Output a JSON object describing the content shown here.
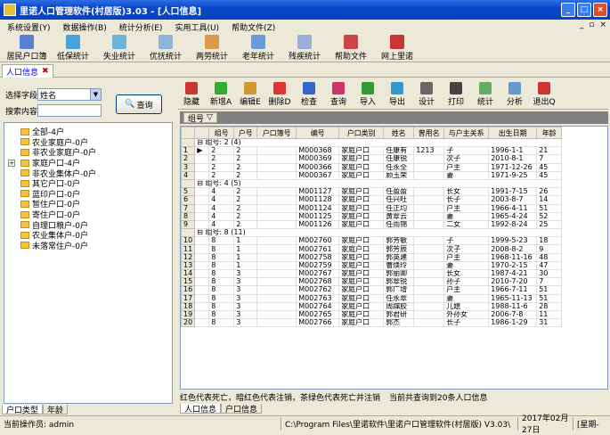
{
  "window": {
    "title": "里诺人口管理软件(村居版)3.03 - [人口信息]",
    "min": "_",
    "max": "□",
    "close": "×"
  },
  "menu": [
    "系统设置(Y)",
    "数据操作(B)",
    "统计分析(E)",
    "实用工具(U)",
    "帮助文件(Z)"
  ],
  "mdi_controls": [
    "_",
    "▫",
    "×"
  ],
  "toolbar": [
    {
      "label": "居民户口簿",
      "icon": "book-icon",
      "color": "#5a7fd6"
    },
    {
      "label": "低保统计",
      "icon": "chart-icon",
      "color": "#4aa2d6"
    },
    {
      "label": "失业统计",
      "icon": "chart-icon",
      "color": "#6cb3d9"
    },
    {
      "label": "优抚统计",
      "icon": "document-icon",
      "color": "#8fb3d9"
    },
    {
      "label": "两劳统计",
      "icon": "chart-icon",
      "color": "#d99a4a"
    },
    {
      "label": "老年统计",
      "icon": "chart-icon",
      "color": "#6c9ad9"
    },
    {
      "label": "残疾统计",
      "icon": "chart-icon",
      "color": "#9ab0d9"
    },
    {
      "label": "帮助文件",
      "icon": "help-icon",
      "color": "#c44"
    },
    {
      "label": "网上里诺",
      "icon": "house-icon",
      "color": "#c33"
    }
  ],
  "doc_tab": "人口信息",
  "search": {
    "field_label": "选择字段",
    "field_value": "姓名",
    "content_label": "搜索内容",
    "content_value": "",
    "button": "查询"
  },
  "tree": [
    {
      "label": "全部-4户",
      "expand": ""
    },
    {
      "label": "农业家庭户-0户",
      "expand": ""
    },
    {
      "label": "非农业家庭户-0户",
      "expand": ""
    },
    {
      "label": "家庭户口-4户",
      "expand": "+"
    },
    {
      "label": "非农业集体户-0户",
      "expand": ""
    },
    {
      "label": "其它户口-0户",
      "expand": ""
    },
    {
      "label": "蓝印户口-0户",
      "expand": ""
    },
    {
      "label": "暂住户口-0户",
      "expand": ""
    },
    {
      "label": "寄住户口-0户",
      "expand": ""
    },
    {
      "label": "自理口粮户-0户",
      "expand": ""
    },
    {
      "label": "农业集体户-0户",
      "expand": ""
    },
    {
      "label": "未落常住户-0户",
      "expand": ""
    }
  ],
  "left_tabs": [
    "户口类型",
    "年龄"
  ],
  "right_toolbar": [
    {
      "label": "隐藏",
      "color": "#c33"
    },
    {
      "label": "新增A",
      "color": "#3a3"
    },
    {
      "label": "编辑E",
      "color": "#c93"
    },
    {
      "label": "删除D",
      "color": "#d33"
    },
    {
      "label": "检查",
      "color": "#36c"
    },
    {
      "label": "查询",
      "color": "#c36"
    },
    {
      "label": "导入",
      "color": "#393"
    },
    {
      "label": "导出",
      "color": "#39c"
    },
    {
      "label": "设计",
      "color": "#666"
    },
    {
      "label": "打印",
      "color": "#444"
    },
    {
      "label": "统计",
      "color": "#6a6"
    },
    {
      "label": "分析",
      "color": "#69c"
    },
    {
      "label": "退出Q",
      "color": "#c33"
    }
  ],
  "group_chip": "组号",
  "columns": [
    "组号",
    "户号",
    "户口簿号",
    "编号",
    "户口类别",
    "姓名",
    "曾用名",
    "与户主关系",
    "出生日期",
    "年龄"
  ],
  "groups": [
    {
      "header": "组号: 2 (4)",
      "rows": [
        [
          "1",
          "2",
          "2",
          "",
          "M000368",
          "家庭户口",
          "任康有",
          "1213",
          "子",
          "1996-1-1",
          "21"
        ],
        [
          "2",
          "2",
          "2",
          "",
          "M000369",
          "家庭户口",
          "任康锐",
          "",
          "次子",
          "2010-8-1",
          "7"
        ],
        [
          "3",
          "2",
          "2",
          "",
          "M000366",
          "家庭户口",
          "任永全",
          "",
          "户主",
          "1971-12-26",
          "45"
        ],
        [
          "4",
          "2",
          "2",
          "",
          "M000367",
          "家庭户口",
          "顾玉荣",
          "",
          "妻",
          "1971-9-25",
          "45"
        ]
      ]
    },
    {
      "header": "组号: 4 (5)",
      "rows": [
        [
          "5",
          "4",
          "2",
          "",
          "M001127",
          "家庭户口",
          "任盈盈",
          "",
          "长女",
          "1991-7-15",
          "26"
        ],
        [
          "6",
          "4",
          "2",
          "",
          "M001128",
          "家庭户口",
          "任兴旺",
          "",
          "长子",
          "2003-8-7",
          "14"
        ],
        [
          "7",
          "4",
          "2",
          "",
          "M001124",
          "家庭户口",
          "任正均",
          "",
          "户主",
          "1966-4-11",
          "51"
        ],
        [
          "8",
          "4",
          "2",
          "",
          "M001125",
          "家庭户口",
          "黄翠云",
          "",
          "妻",
          "1965-4-24",
          "52"
        ],
        [
          "9",
          "4",
          "2",
          "",
          "M001126",
          "家庭户口",
          "任雨锦",
          "",
          "二女",
          "1992-8-24",
          "25"
        ]
      ]
    },
    {
      "header": "组号: 8 (11)",
      "rows": [
        [
          "10",
          "8",
          "1",
          "",
          "M002760",
          "家庭户口",
          "郭芳敏",
          "",
          "子",
          "1999-5-23",
          "18"
        ],
        [
          "11",
          "8",
          "1",
          "",
          "M002761",
          "家庭户口",
          "郭芳辰",
          "",
          "次子",
          "2008-8-2",
          "9"
        ],
        [
          "12",
          "8",
          "1",
          "",
          "M002758",
          "家庭户口",
          "郭英建",
          "",
          "户主",
          "1968-11-16",
          "48"
        ],
        [
          "13",
          "8",
          "1",
          "",
          "M002759",
          "家庭户口",
          "曹焕玲",
          "",
          "妻",
          "1970-2-15",
          "47"
        ],
        [
          "14",
          "8",
          "3",
          "",
          "M002767",
          "家庭户口",
          "郭丽卿",
          "",
          "长女",
          "1987-4-21",
          "30"
        ],
        [
          "15",
          "8",
          "3",
          "",
          "M002768",
          "家庭户口",
          "郭翠锐",
          "",
          "孙子",
          "2010-7-20",
          "7"
        ],
        [
          "16",
          "8",
          "3",
          "",
          "M002762",
          "家庭户口",
          "郭广增",
          "",
          "户主",
          "1966-7-11",
          "51"
        ],
        [
          "17",
          "8",
          "3",
          "",
          "M002763",
          "家庭户口",
          "任永翠",
          "",
          "妻",
          "1965-11-13",
          "51"
        ],
        [
          "18",
          "8",
          "3",
          "",
          "M002764",
          "家庭户口",
          "周蹿胶",
          "",
          "儿媳",
          "1988-11-6",
          "28"
        ],
        [
          "19",
          "8",
          "3",
          "",
          "M002765",
          "家庭户口",
          "郭君研",
          "",
          "外孙女",
          "2006-7-8",
          "11"
        ],
        [
          "20",
          "8",
          "3",
          "",
          "M002766",
          "家庭户口",
          "郭杰",
          "",
          "长子",
          "1986-1-29",
          "31"
        ]
      ]
    }
  ],
  "legend_text": "红色代表死亡，暗红色代表注销，茶绿色代表死亡并注销",
  "count_text": "当前共查询到20条人口信息",
  "right_tabs": [
    "人口信息",
    "户口信息"
  ],
  "status": {
    "operator": "当前操作员: admin",
    "path": "C:\\Program Files\\里诺软件\\里诺户口管理软件(村居版) V3.03\\",
    "date": "2017年02月27日",
    "weekday": "[星期-"
  }
}
